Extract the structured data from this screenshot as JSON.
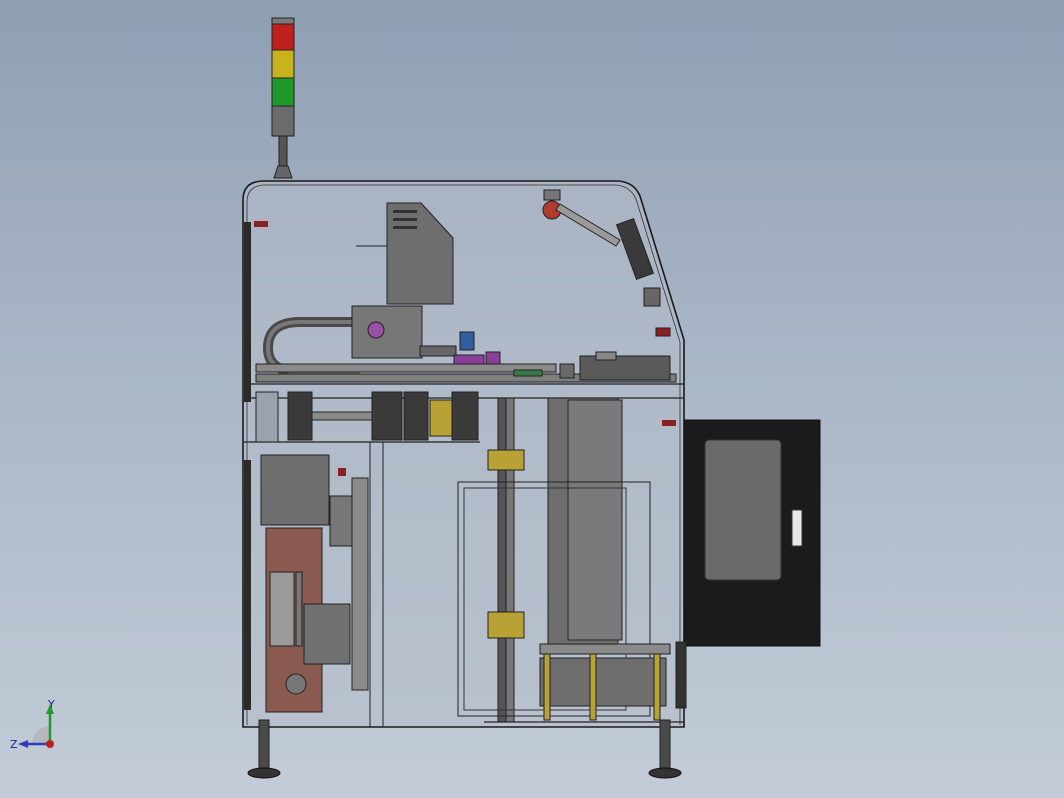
{
  "scene": {
    "background_top": "#8f9fb3",
    "background_bottom": "#c3ccd8",
    "colors": {
      "frame_edge": "#1c1c1c",
      "panel_glass": "#b6bec9",
      "metal_gray": "#6e6e6e",
      "dark_metal": "#4a4a4a",
      "copper_plate": "#8a5a50",
      "door_black": "#1b1b1b",
      "door_window": "#6a6a6a",
      "signal_red": "#c0201c",
      "signal_yellow": "#c8b21e",
      "signal_green": "#1f9a2a",
      "accent_yellow": "#b9a235",
      "accent_purple": "#8a3f9a",
      "accent_blue": "#2f5fa0"
    }
  },
  "triad": {
    "y_label": "Y",
    "z_label": "Z",
    "icon": "coordinate-axes-icon"
  }
}
